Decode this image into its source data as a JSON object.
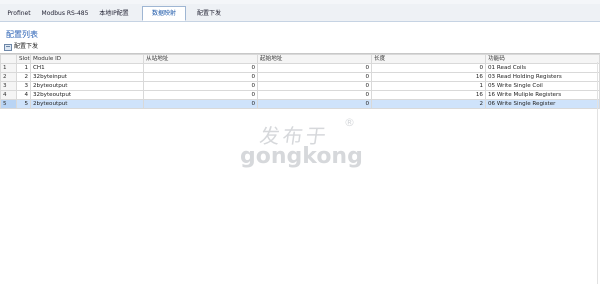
{
  "top_fragment": "·· ··",
  "tabs": [
    {
      "label": "Profinet"
    },
    {
      "label": "Modbus RS-485"
    },
    {
      "label": "本地IP配置"
    },
    {
      "label": "数据映射"
    },
    {
      "label": "配置下发"
    }
  ],
  "active_tab": "数据映射",
  "section_title": "配置列表",
  "toolbar": {
    "download_label": "配置下发"
  },
  "table": {
    "columns": [
      "Slot",
      "Module ID",
      "从站地址",
      "起始地址",
      "长度",
      "功能码"
    ],
    "rows": [
      {
        "row": "1",
        "slot": "1",
        "module": "CH1",
        "slave": "0",
        "start": "0",
        "len": "0",
        "func": "01 Read Coils"
      },
      {
        "row": "2",
        "slot": "2",
        "module": "32byteinput",
        "slave": "0",
        "start": "0",
        "len": "16",
        "func": "03 Read Holding Registers"
      },
      {
        "row": "3",
        "slot": "3",
        "module": "2byteoutput",
        "slave": "0",
        "start": "0",
        "len": "1",
        "func": "05 Write Single Coil"
      },
      {
        "row": "4",
        "slot": "4",
        "module": "32byteoutput",
        "slave": "0",
        "start": "0",
        "len": "16",
        "func": "16 Write Muliple Registers"
      },
      {
        "row": "5",
        "slot": "5",
        "module": "2byteoutput",
        "slave": "0",
        "start": "0",
        "len": "2",
        "func": "06 Write Single Register"
      }
    ],
    "selected_row": 5
  },
  "watermark": {
    "line1": "发布于",
    "line2": "gongkong",
    "reg": "®"
  }
}
